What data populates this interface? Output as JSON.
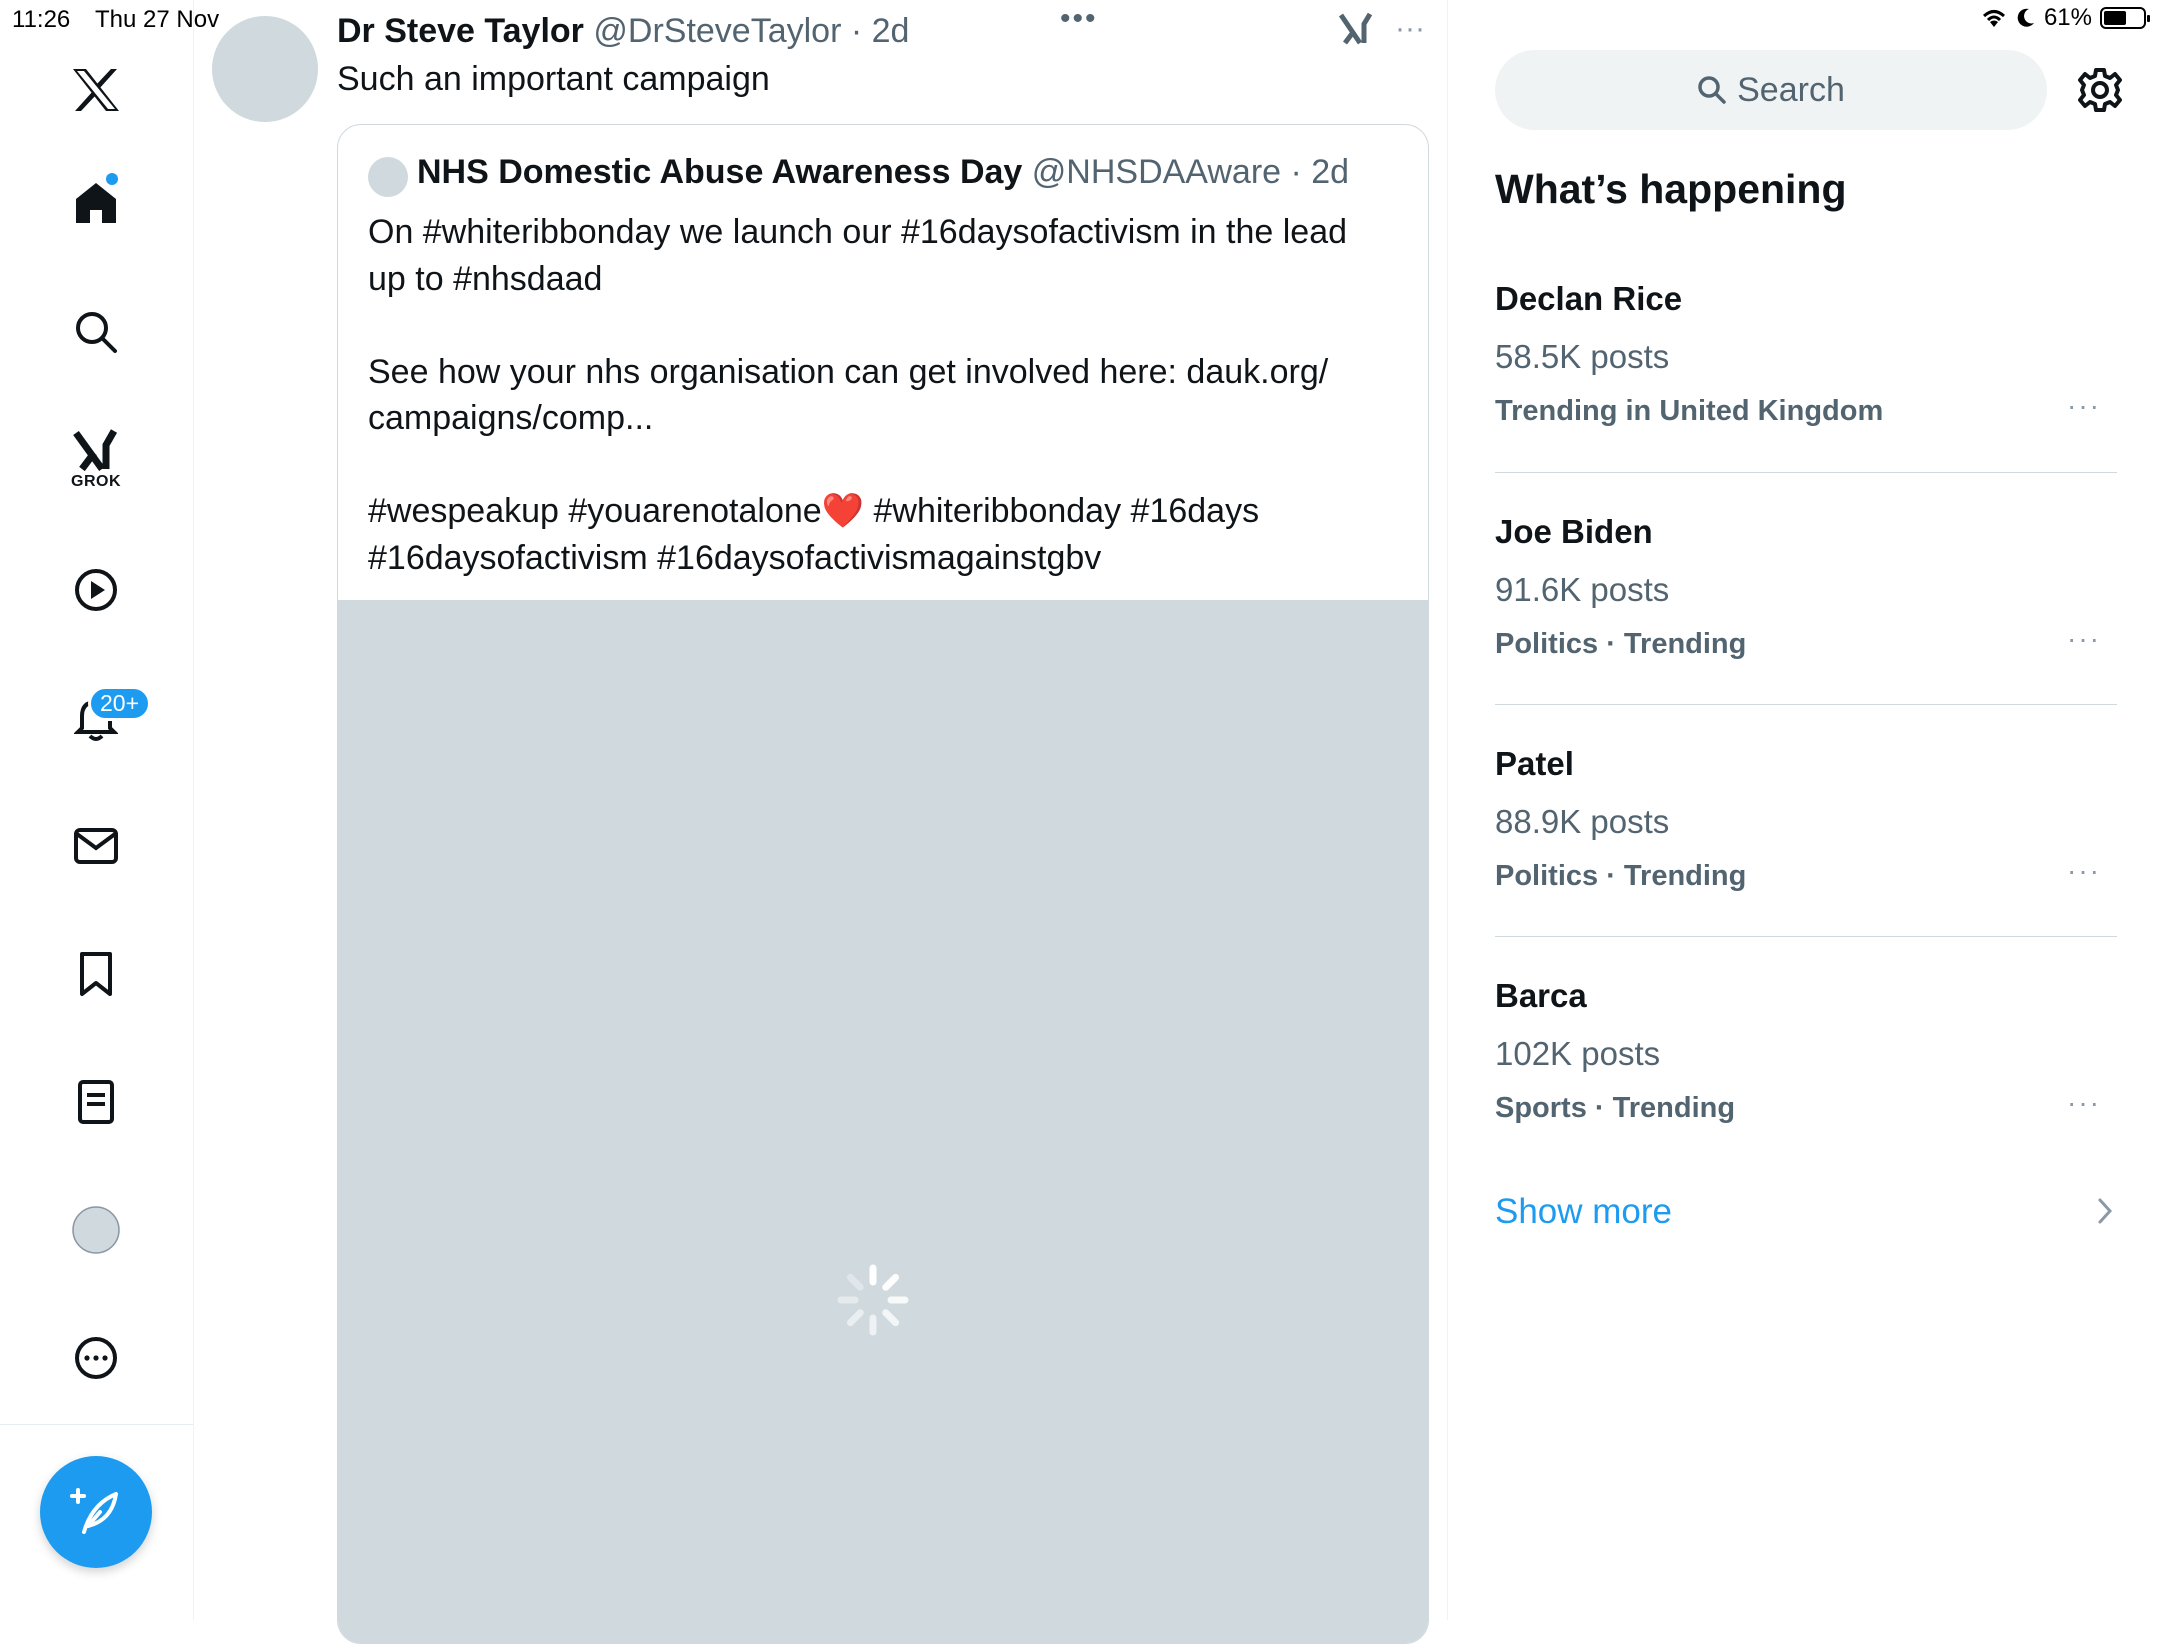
{
  "status_bar": {
    "time": "11:26",
    "date": "Thu 27 Nov",
    "battery": "61%",
    "battery_level": 0.61
  },
  "nav": {
    "grok_label": "GROK",
    "notifications_badge": "20+",
    "items": [
      "x-logo-icon",
      "home-icon",
      "search-icon",
      "grok-icon",
      "video-icon",
      "bell-icon",
      "mail-icon",
      "bookmark-icon",
      "list-icon",
      "profile-avatar",
      "more-icon",
      "compose-icon"
    ]
  },
  "tweet": {
    "author_name": "Dr Steve Taylor",
    "author_meta": "@DrSteveTaylor · 2d",
    "text": "Such an important campaign",
    "top_more": "•••",
    "menu": "···"
  },
  "quote": {
    "author_name": "NHS Domestic Abuse Awareness Day",
    "author_meta": "@NHSDAAware · 2d",
    "line1": "On #whiteribbonday we launch our #16daysofactivism in the lead",
    "line2": "up to #nhsdaad",
    "line3": "See how your nhs organisation can get involved here: dauk.org/",
    "line4": "campaigns/comp...",
    "line5_a": "#wespeakup #youarenotalone",
    "line5_emoji": "❤️",
    "line5_b": " #whiteribbonday #16days",
    "line6": "#16daysofactivism #16daysofactivismagainstgbv"
  },
  "sidebar": {
    "search_placeholder": "Search",
    "section_title": "What’s happening",
    "trends": [
      {
        "name": "Declan Rice",
        "posts": "58.5K posts",
        "context": "Trending in United Kingdom"
      },
      {
        "name": "Joe Biden",
        "posts": "91.6K posts",
        "context": "Politics · Trending"
      },
      {
        "name": "Patel",
        "posts": "88.9K posts",
        "context": "Politics · Trending"
      },
      {
        "name": "Barca",
        "posts": "102K posts",
        "context": "Sports · Trending"
      }
    ],
    "trend_more": "···",
    "show_more": "Show more"
  },
  "colors": {
    "accent": "#1d9bf0",
    "text": "#0f1419",
    "muted": "#536471",
    "media_bg": "#cfd9de"
  }
}
